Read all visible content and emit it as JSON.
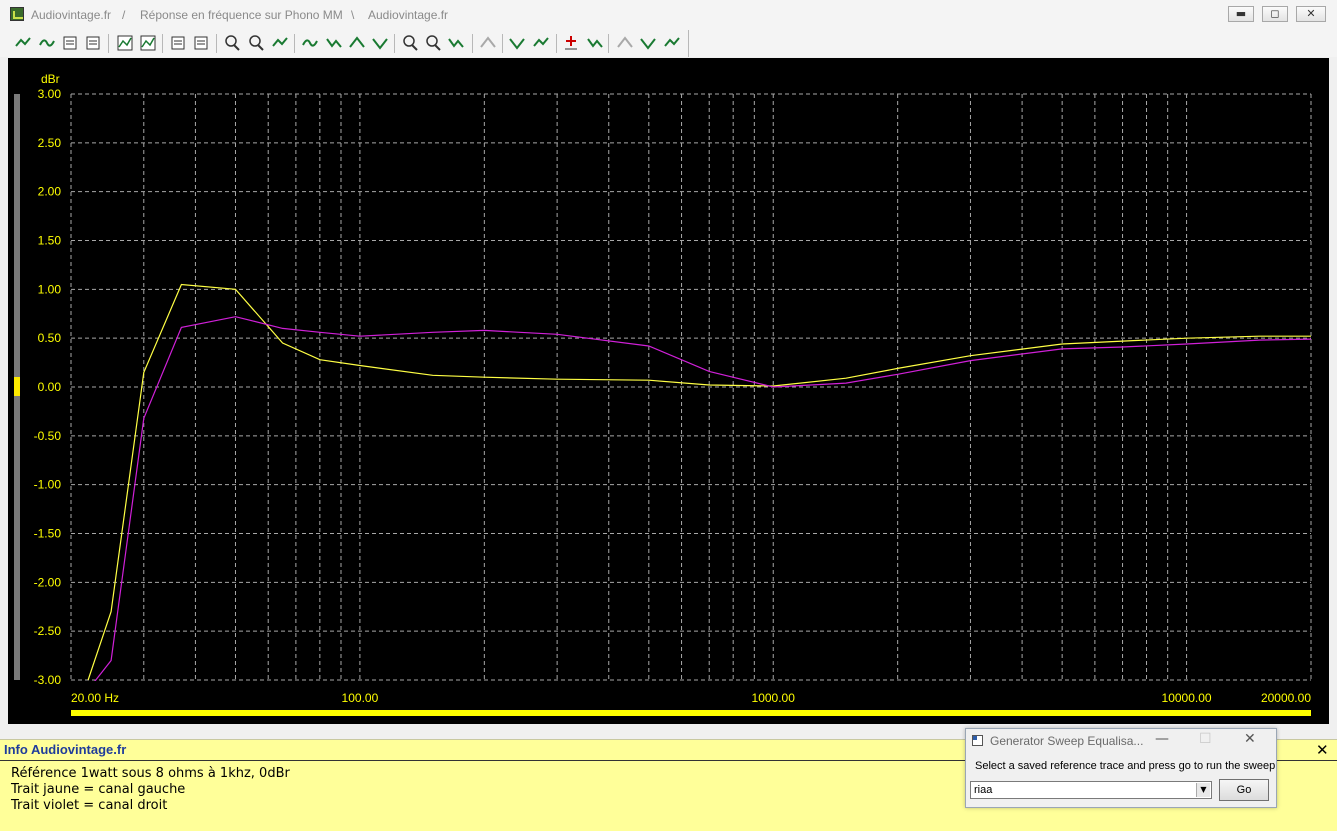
{
  "window": {
    "title_parts": [
      "Audiovintage.fr",
      "/",
      "Réponse en fréquence sur Phono MM",
      "\\",
      "Audiovintage.fr"
    ],
    "minimize_symbol": "▬",
    "maximize_symbol": "◻",
    "close_symbol": "✕"
  },
  "toolbar": {
    "icons": [
      "add-trace-icon",
      "trace-wave-icon",
      "save-icon",
      "copy-icon",
      "graph-view-icon",
      "settings-grid-icon",
      "notes-icon",
      "data-list-icon",
      "zoom-fit-icon",
      "zoom-box-icon",
      "trace-line-icon",
      "peak-up-icon",
      "peak-down-icon",
      "curve-up-icon",
      "curve-down-icon",
      "zoom-in-icon",
      "zoom-out-icon",
      "wave-compare-icon",
      "disabled-tool-icon",
      "marker-up-icon",
      "marker-down-icon",
      "add-marker-icon",
      "move-marker-icon",
      "ref-curve-icon",
      "eq-curve-icon",
      "equalise-icon"
    ]
  },
  "chart_data": {
    "type": "line",
    "ylabel": "dBr",
    "ylim": [
      -3.0,
      3.0
    ],
    "y_ticks": [
      "3.00",
      "2.50",
      "2.00",
      "1.50",
      "1.00",
      "0.50",
      "0.00",
      "-0.50",
      "-1.00",
      "-1.50",
      "-2.00",
      "-2.50",
      "-3.00"
    ],
    "xscale": "log",
    "xlim": [
      20,
      20000
    ],
    "x_tick_labels": [
      {
        "value": 20,
        "label": "20.00 Hz"
      },
      {
        "value": 100,
        "label": "100.00"
      },
      {
        "value": 1000,
        "label": "1000.00"
      },
      {
        "value": 10000,
        "label": "10000.00"
      },
      {
        "value": 20000,
        "label": "20000.00"
      }
    ],
    "grid": true,
    "background": "#000000",
    "grid_color": "#a8a8a8",
    "axis_text_color": "#ffff00",
    "series": [
      {
        "color": "#ffff44",
        "x": [
          22,
          25,
          30,
          37,
          50,
          65,
          80,
          100,
          150,
          200,
          300,
          500,
          700,
          1000,
          1500,
          2000,
          3000,
          5000,
          7000,
          10000,
          15000,
          20000
        ],
        "y": [
          -3.0,
          -2.3,
          0.15,
          1.05,
          1.0,
          0.45,
          0.28,
          0.22,
          0.12,
          0.1,
          0.08,
          0.07,
          0.02,
          0.01,
          0.09,
          0.19,
          0.32,
          0.44,
          0.47,
          0.5,
          0.52,
          0.52
        ]
      },
      {
        "color": "#d020d8",
        "x": [
          22,
          25,
          30,
          37,
          50,
          65,
          80,
          100,
          150,
          200,
          300,
          500,
          700,
          1000,
          1500,
          2000,
          3000,
          5000,
          7000,
          10000,
          15000,
          20000
        ],
        "y": [
          -3.1,
          -2.8,
          -0.32,
          0.61,
          0.72,
          0.6,
          0.56,
          0.52,
          0.56,
          0.58,
          0.54,
          0.42,
          0.16,
          0.0,
          0.04,
          0.13,
          0.27,
          0.39,
          0.41,
          0.44,
          0.48,
          0.49
        ]
      }
    ]
  },
  "info_panel": {
    "title": "Info Audiovintage.fr",
    "lines": [
      "Référence 1watt sous 8 ohms à 1khz, 0dBr",
      "Trait jaune = canal gauche",
      "Trait violet = canal droit"
    ],
    "close_symbol": "✕"
  },
  "dialog": {
    "title": "Generator Sweep Equalisa...",
    "minimize_symbol": "—",
    "maximize_symbol": "☐",
    "close_symbol": "✕",
    "prompt": "Select a saved reference trace and press go to run the sweep",
    "selected_trace": "riaa",
    "dropdown_symbol": "▼",
    "go_label": "Go"
  }
}
